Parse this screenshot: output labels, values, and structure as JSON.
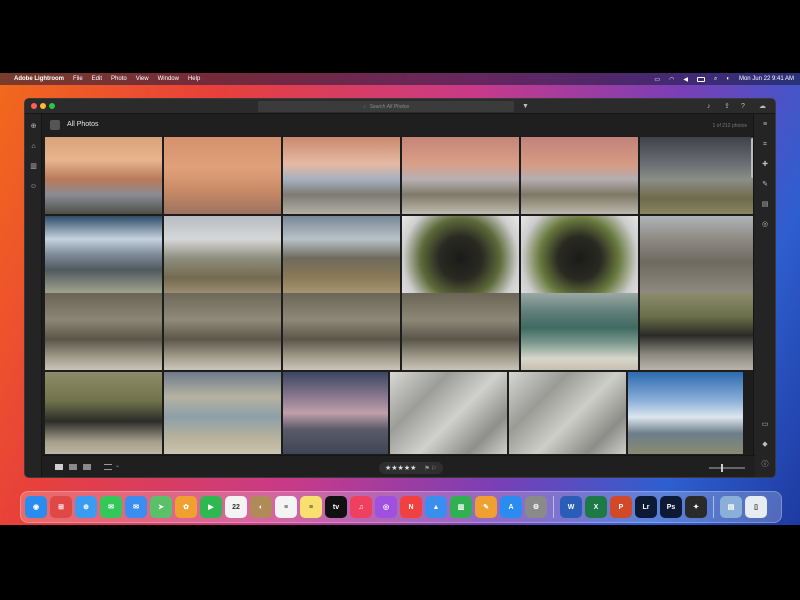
{
  "menubar": {
    "app_name": "Adobe Lightroom",
    "items": [
      "File",
      "Edit",
      "Photo",
      "View",
      "Window",
      "Help"
    ],
    "clock": "Mon Jun 22  9:41 AM"
  },
  "toolbar": {
    "search_placeholder": "Search All Photos"
  },
  "header": {
    "title": "All Photos",
    "count": "1 of 212 photos"
  },
  "grid": {
    "rows": [
      {
        "tiles": [
          {
            "name": "sunset-clouds-beach",
            "bg": "linear-gradient(180deg,#d9a37a 0%,#e8b48c 30%,#b87a5a 55%,#8a8c94 75%,#4e4e48 100%)"
          },
          {
            "name": "rain-shower-sunset",
            "bg": "linear-gradient(180deg,#d3926d 0%,#e0a07a 40%,#c88a66 70%,#9a7360 100%)"
          },
          {
            "name": "rainbow-penguin-colony-1",
            "bg": "linear-gradient(180deg,#c98a6e 0%,#e6b9a4 35%,#a6b0c0 55%,#7d7c72 75%,#b3afa6 100%)"
          },
          {
            "name": "rainbow-penguin-colony-2",
            "bg": "linear-gradient(180deg,#c5857a 0%,#d99f86 35%,#b8b0b4 55%,#807a6a 75%,#c0bbb0 100%)"
          },
          {
            "name": "rainbow-penguin-colony-3",
            "bg": "linear-gradient(180deg,#c1837a 0%,#d69a82 35%,#b4aeb2 55%,#7e7866 75%,#bcb8ac 100%)"
          },
          {
            "name": "dark-sky-grassland",
            "bg": "linear-gradient(180deg,#3f4248 0%,#6b6e74 35%,#8a8e86 55%,#6f6a4a 80%,#8a8560 100%)"
          }
        ]
      },
      {
        "tiles": [
          {
            "name": "storm-clouds-coast",
            "bg": "linear-gradient(180deg,#2f4c68 0%,#c6d2de 30%,#7e8b98 50%,#4f5a5e 70%,#a0a38e 100%)"
          },
          {
            "name": "rolling-hills",
            "bg": "linear-gradient(180deg,#b8bcc0 0%,#d6d8d8 30%,#8e8e7e 55%,#746a50 80%,#9a8c70 100%)"
          },
          {
            "name": "rocky-ridge",
            "bg": "linear-gradient(180deg,#7a8896 0%,#b8c2c8 30%,#6e6a5c 55%,#8a7a58 80%,#a89470 100%)"
          },
          {
            "name": "penguin-burrow-1",
            "bg": "radial-gradient(circle at 50% 55%,#1a1a1a 0%,#2a2a22 30%,#5e6a3a 55%,#cfcfcf 80%,#e8e8e8 100%)"
          },
          {
            "name": "penguin-burrow-2",
            "bg": "radial-gradient(circle at 50% 55%,#1a1a1a 0%,#2a2a22 30%,#6a7a3e 55%,#cdcdcd 80%,#e6e6e6 100%)"
          },
          {
            "name": "rock-formations",
            "bg": "linear-gradient(180deg,#b0b4b8 0%,#8c8a82 30%,#6e6a60 60%,#8e8a7e 100%)"
          }
        ]
      },
      {
        "tiles": [
          {
            "name": "rocks-beach-1",
            "bg": "linear-gradient(180deg,#6a6456 0%,#8c8676 35%,#5a554a 60%,#a6a090 85%,#c8c4b8 100%)"
          },
          {
            "name": "rocks-beach-2",
            "bg": "linear-gradient(180deg,#6e685a 0%,#908a7a 35%,#5c574c 60%,#a8a292 85%,#cac6ba 100%)"
          },
          {
            "name": "rocks-beach-3",
            "bg": "linear-gradient(180deg,#6c6658 0%,#8e8878 35%,#5b564b 60%,#a7a191 85%,#c9c5b9 100%)"
          },
          {
            "name": "rocks-beach-4",
            "bg": "linear-gradient(180deg,#6b6557 0%,#8d8777 35%,#5a554a 60%,#a6a090 85%,#c8c4b8 100%)"
          },
          {
            "name": "ocean-wave-shore",
            "bg": "linear-gradient(180deg,#9aa8a4 0%,#5e7e78 25%,#3f6a62 45%,#7c9a8e 65%,#d8d6cc 85%,#c6c0b0 100%)"
          },
          {
            "name": "penguins-on-grass",
            "bg": "linear-gradient(180deg,#8a8c6e 0%,#6c7048 30%,#2a2a28 55%,#8c8a80 80%,#b8b4a8 100%)"
          }
        ]
      },
      {
        "tiles": [
          {
            "name": "penguins-grassland",
            "bg": "linear-gradient(180deg,#8e8c6a 0%,#70744a 35%,#2c2c2a 60%,#a49e8a 85%,#bcb6a4 100%)"
          },
          {
            "name": "coastal-bay",
            "bg": "linear-gradient(180deg,#6e7c8a 0%,#b6b2a0 30%,#8ca0a8 55%,#b8b29c 80%,#cac4b0 100%)"
          },
          {
            "name": "dusk-shipwreck",
            "bg": "linear-gradient(180deg,#3a4660 0%,#8a7890 30%,#c0a0a8 50%,#5a5a6a 70%,#3e4654 100%)"
          },
          {
            "name": "lichen-rock-1",
            "bg": "linear-gradient(135deg,#d8d8d4 0%,#9c9c98 30%,#d0d0cc 55%,#8e8e8a 80%,#cfcfcb 100%)"
          },
          {
            "name": "lichen-rock-2",
            "bg": "linear-gradient(135deg,#d6d6d2 0%,#9a9a96 30%,#cecec8 55%,#8c8c88 80%,#cdcdc9 100%)"
          },
          {
            "name": "blue-sky-town",
            "bg": "linear-gradient(180deg,#2c6ab0 0%,#8cb0d8 35%,#dce6ee 55%,#6c7e8a 75%,#8a8a70 100%)"
          }
        ]
      }
    ]
  },
  "rating": {
    "stars": "★★★★★",
    "flags": "⚑ ⚐"
  },
  "dock": {
    "apps": [
      {
        "name": "finder",
        "color": "#2a8cf0",
        "label": "◉"
      },
      {
        "name": "launchpad",
        "color": "#e04848",
        "label": "⊞"
      },
      {
        "name": "safari",
        "color": "#3a9cf0",
        "label": "⊕"
      },
      {
        "name": "messages",
        "color": "#34c759",
        "label": "✉"
      },
      {
        "name": "mail",
        "color": "#3a8ef0",
        "label": "✉"
      },
      {
        "name": "maps",
        "color": "#5ac06a",
        "label": "➤"
      },
      {
        "name": "photos",
        "color": "#f0a030",
        "label": "✿"
      },
      {
        "name": "facetime",
        "color": "#30b850",
        "label": "▶"
      },
      {
        "name": "calendar",
        "color": "#f4f4f4",
        "label": "22"
      },
      {
        "name": "contacts",
        "color": "#b08a58",
        "label": "◐"
      },
      {
        "name": "reminders",
        "color": "#f4f4f4",
        "label": "≡"
      },
      {
        "name": "notes",
        "color": "#f8e070",
        "label": "≡"
      },
      {
        "name": "apple-tv",
        "color": "#111111",
        "label": "tv"
      },
      {
        "name": "music",
        "color": "#f04060",
        "label": "♫"
      },
      {
        "name": "podcasts",
        "color": "#a050e0",
        "label": "◎"
      },
      {
        "name": "news",
        "color": "#f04040",
        "label": "N"
      },
      {
        "name": "keynote",
        "color": "#3a8ef0",
        "label": "▲"
      },
      {
        "name": "numbers",
        "color": "#30b050",
        "label": "▥"
      },
      {
        "name": "pages",
        "color": "#f0a030",
        "label": "✎"
      },
      {
        "name": "app-store",
        "color": "#2a8cf0",
        "label": "A"
      },
      {
        "name": "system-preferences",
        "color": "#8a8a8a",
        "label": "⚙"
      }
    ],
    "apps2": [
      {
        "name": "word",
        "color": "#2b5cb8",
        "label": "W"
      },
      {
        "name": "excel",
        "color": "#1e7a44",
        "label": "X"
      },
      {
        "name": "powerpoint",
        "color": "#d04a2a",
        "label": "P"
      },
      {
        "name": "lightroom",
        "color": "#0c1a36",
        "label": "Lr"
      },
      {
        "name": "photoshop",
        "color": "#0c1a36",
        "label": "Ps"
      },
      {
        "name": "final-cut",
        "color": "#2a2a2a",
        "label": "✦"
      }
    ],
    "apps3": [
      {
        "name": "downloads",
        "color": "#8ab0d8",
        "label": "▤"
      },
      {
        "name": "trash",
        "color": "#e6ecf2",
        "label": "▯"
      }
    ]
  }
}
